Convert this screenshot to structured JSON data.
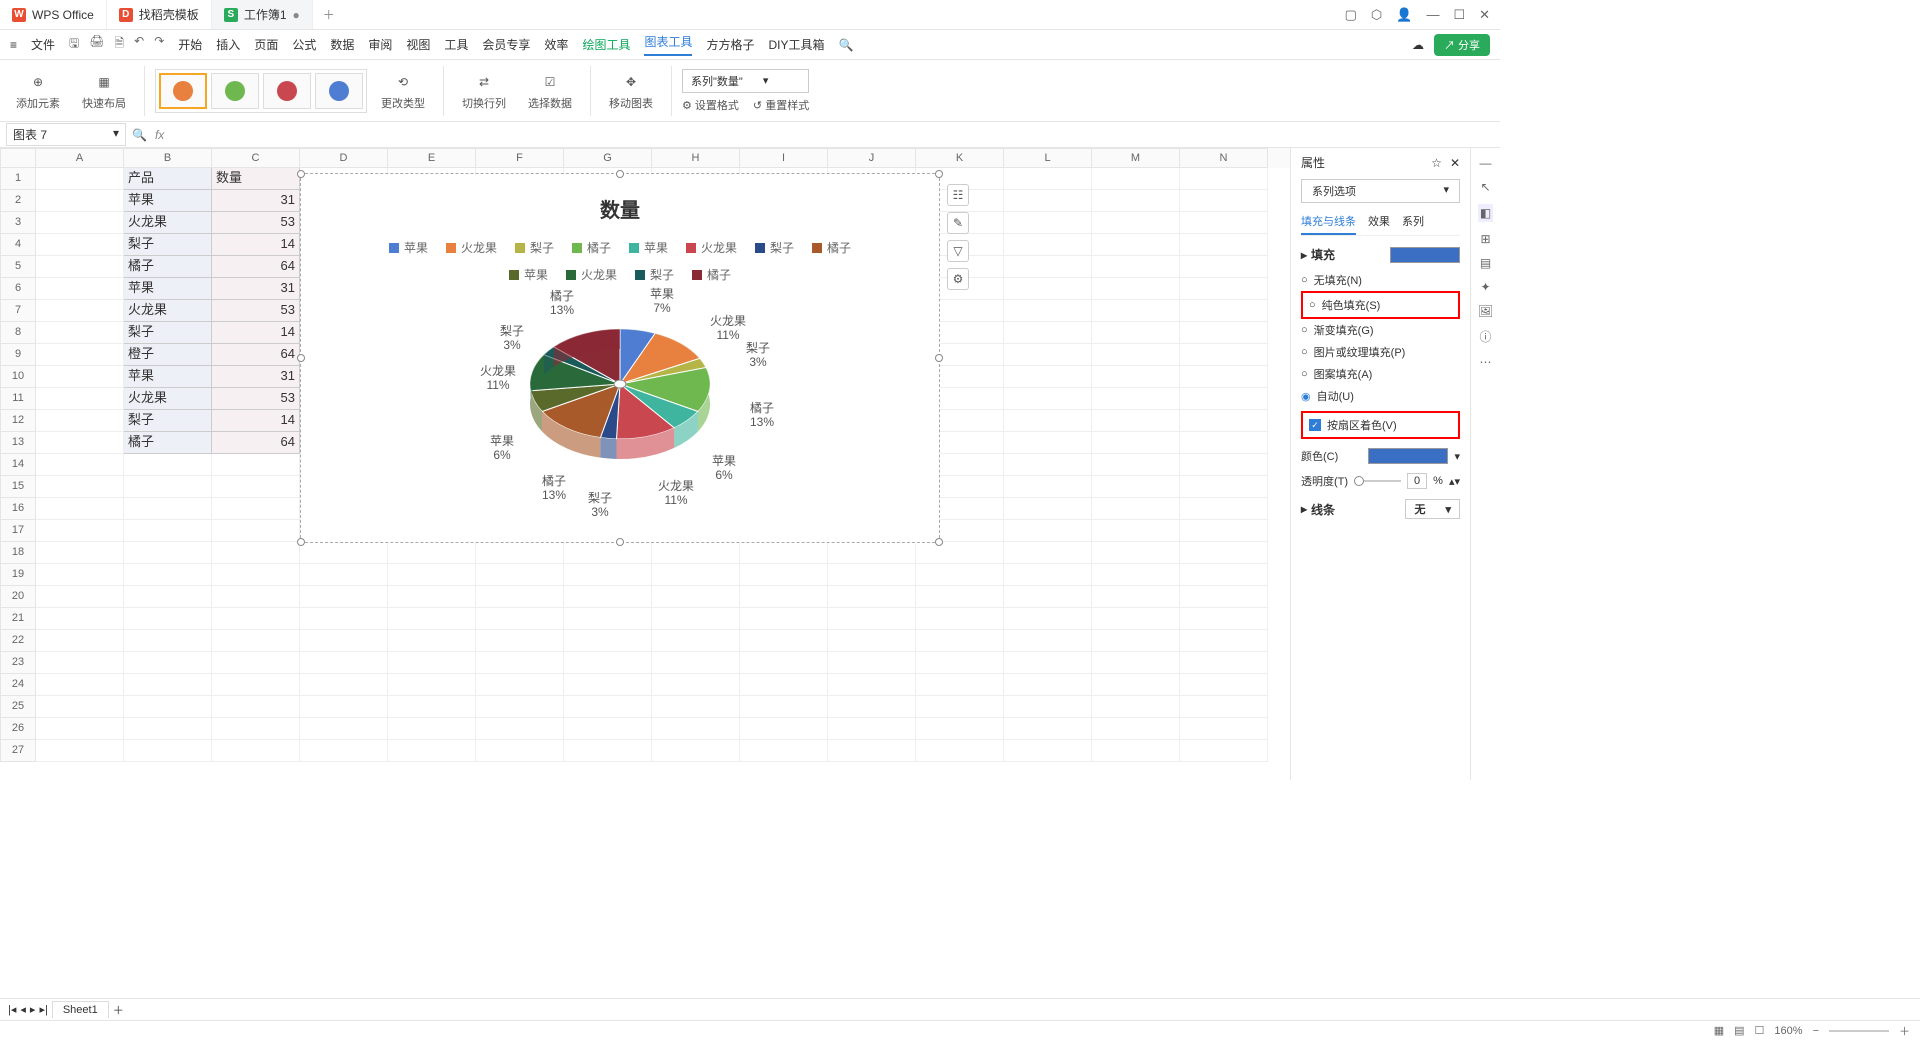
{
  "tabs": [
    {
      "icon": "W",
      "color": "#e84e31",
      "label": "WPS Office"
    },
    {
      "icon": "D",
      "color": "#e84e31",
      "label": "找稻壳模板"
    },
    {
      "icon": "S",
      "color": "#2aaa5b",
      "label": "工作簿1",
      "active": true
    }
  ],
  "menu": {
    "file": "文件",
    "items": [
      "开始",
      "插入",
      "页面",
      "公式",
      "数据",
      "审阅",
      "视图",
      "工具",
      "会员专享",
      "效率"
    ],
    "green": "绘图工具",
    "blue": "图表工具",
    "extra": [
      "方方格子",
      "DIY工具箱"
    ]
  },
  "share": "分享",
  "ribbon": {
    "add": "添加元素",
    "quick": "快速布局",
    "changeType": "更改类型",
    "switchRC": "切换行列",
    "selData": "选择数据",
    "move": "移动图表",
    "setFmt": "设置格式",
    "resetStyle": "重置样式",
    "seriesSelect": "系列\"数量\""
  },
  "nameBox": "图表 7",
  "cols": [
    "A",
    "B",
    "C",
    "D",
    "E",
    "F",
    "G",
    "H",
    "I",
    "J",
    "K",
    "L",
    "M",
    "N"
  ],
  "data": {
    "header": [
      "产品",
      "数量"
    ],
    "rows": [
      [
        "苹果",
        "31"
      ],
      [
        "火龙果",
        "53"
      ],
      [
        "梨子",
        "14"
      ],
      [
        "橘子",
        "64"
      ],
      [
        "苹果",
        "31"
      ],
      [
        "火龙果",
        "53"
      ],
      [
        "梨子",
        "14"
      ],
      [
        "橙子",
        "64"
      ],
      [
        "苹果",
        "31"
      ],
      [
        "火龙果",
        "53"
      ],
      [
        "梨子",
        "14"
      ],
      [
        "橘子",
        "64"
      ]
    ]
  },
  "chart_data": {
    "type": "pie",
    "title": "数量",
    "series": [
      {
        "name": "苹果",
        "value": 31,
        "pct": "7%",
        "color": "#4f7dd1"
      },
      {
        "name": "火龙果",
        "value": 53,
        "pct": "11%",
        "color": "#e8803f"
      },
      {
        "name": "梨子",
        "value": 14,
        "pct": "3%",
        "color": "#b5b547"
      },
      {
        "name": "橘子",
        "value": 64,
        "pct": "13%",
        "color": "#6fb84f"
      },
      {
        "name": "苹果",
        "value": 31,
        "pct": "6%",
        "color": "#3fb5a0"
      },
      {
        "name": "火龙果",
        "value": 53,
        "pct": "11%",
        "color": "#c94850"
      },
      {
        "name": "梨子",
        "value": 14,
        "pct": "3%",
        "color": "#2a4a8a"
      },
      {
        "name": "橘子",
        "value": 64,
        "pct": "13%",
        "color": "#a85a2a"
      },
      {
        "name": "苹果",
        "value": 31,
        "pct": "6%",
        "color": "#5a6a2a"
      },
      {
        "name": "火龙果",
        "value": 53,
        "pct": "11%",
        "color": "#2a6a3a"
      },
      {
        "name": "梨子",
        "value": 14,
        "pct": "3%",
        "color": "#1a5a5a"
      },
      {
        "name": "橘子",
        "value": 64,
        "pct": "13%",
        "color": "#8a2a35"
      }
    ]
  },
  "side": {
    "title": "属性",
    "dropdown": "系列选项",
    "tabs": [
      "填充与线条",
      "效果",
      "系列"
    ],
    "fillTitle": "填充",
    "fillOpts": [
      "无填充(N)",
      "纯色填充(S)",
      "渐变填充(G)",
      "图片或纹理填充(P)",
      "图案填充(A)",
      "自动(U)"
    ],
    "cbColor": "按扇区着色(V)",
    "colorLabel": "颜色(C)",
    "opacityLabel": "透明度(T)",
    "opacityVal": "0",
    "opacityUnit": "%",
    "lineTitle": "线条",
    "lineVal": "无"
  },
  "sheetTab": "Sheet1",
  "zoom": "160%"
}
